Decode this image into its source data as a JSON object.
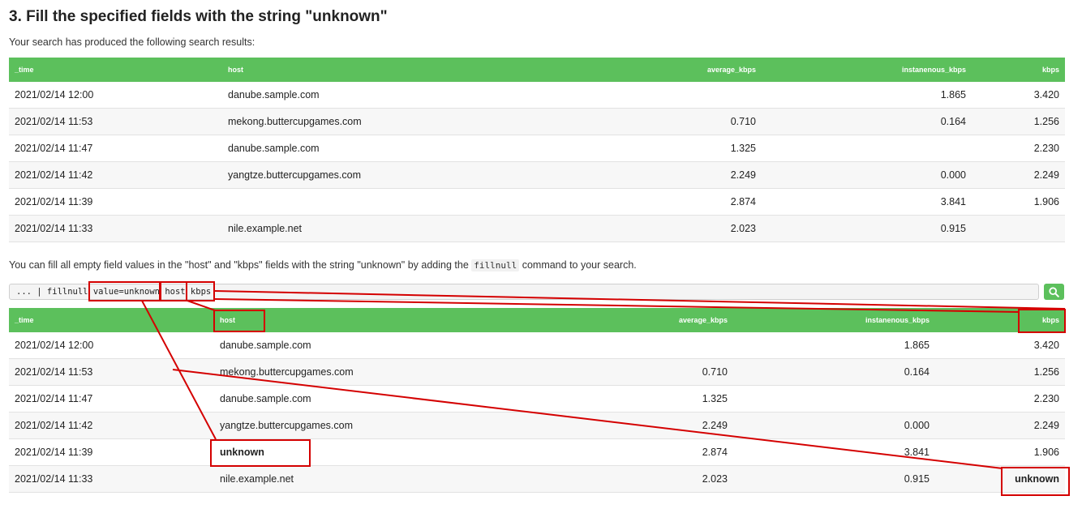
{
  "heading": "3. Fill the specified fields with the string \"unknown\"",
  "intro": "Your search has produced the following search results:",
  "columns": [
    "_time",
    "host",
    "average_kbps",
    "instanenous_kbps",
    "kbps"
  ],
  "results_before": [
    [
      "2021/02/14 12:00",
      "danube.sample.com",
      "",
      "1.865",
      "3.420"
    ],
    [
      "2021/02/14 11:53",
      "mekong.buttercupgames.com",
      "0.710",
      "0.164",
      "1.256"
    ],
    [
      "2021/02/14 11:47",
      "danube.sample.com",
      "1.325",
      "",
      "2.230"
    ],
    [
      "2021/02/14 11:42",
      "yangtze.buttercupgames.com",
      "2.249",
      "0.000",
      "2.249"
    ],
    [
      "2021/02/14 11:39",
      "",
      "2.874",
      "3.841",
      "1.906"
    ],
    [
      "2021/02/14 11:33",
      "nile.example.net",
      "2.023",
      "0.915",
      ""
    ]
  ],
  "description": {
    "before_code": "You can fill all empty field values in the \"host\" and \"kbps\" fields with the string \"unknown\" by adding the ",
    "code": "fillnull",
    "after_code": " command to your search."
  },
  "search_query": "... | fillnull value=unknown host kbps",
  "search_icon": "magnifier-icon",
  "results_after": [
    [
      "2021/02/14 12:00",
      "danube.sample.com",
      "",
      "1.865",
      "3.420"
    ],
    [
      "2021/02/14 11:53",
      "mekong.buttercupgames.com",
      "0.710",
      "0.164",
      "1.256"
    ],
    [
      "2021/02/14 11:47",
      "danube.sample.com",
      "1.325",
      "",
      "2.230"
    ],
    [
      "2021/02/14 11:42",
      "yangtze.buttercupgames.com",
      "2.249",
      "0.000",
      "2.249"
    ],
    [
      "2021/02/14 11:39",
      "unknown",
      "2.874",
      "3.841",
      "1.906"
    ],
    [
      "2021/02/14 11:33",
      "nile.example.net",
      "2.023",
      "0.915",
      "unknown"
    ]
  ],
  "colors": {
    "header_green": "#5cc05c",
    "highlight_red": "#d40000"
  }
}
